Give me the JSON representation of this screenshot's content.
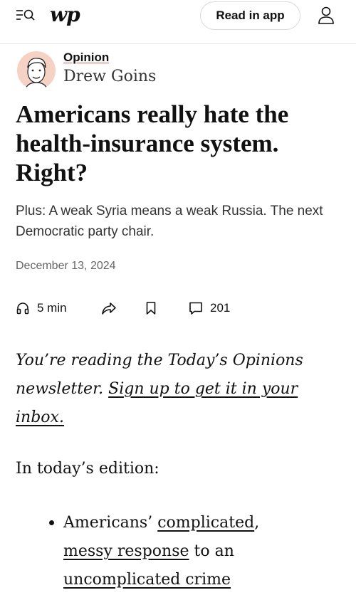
{
  "header": {
    "logo_text": "wp",
    "read_in_app_label": "Read in app"
  },
  "article": {
    "section": "Opinion",
    "author": "Drew Goins",
    "headline": "Americans really hate the health-insurance system. Right?",
    "subhead": "Plus: A weak Syria means a weak Russia. The next Democratic party chair.",
    "date": "December 13, 2024",
    "actions": {
      "listen_label": "5 min",
      "comments_count": "201"
    },
    "intro": {
      "text_before": "You’re reading the Today’s Opinions newsletter. ",
      "link_text": "Sign up to get it in your inbox."
    },
    "edition_heading": "In today’s edition:",
    "bullets": [
      {
        "prefix": "Americans’ ",
        "link1": "complicated",
        "sep": ", ",
        "link2": "messy response",
        "middle": " to an ",
        "link3": "uncomplicated crime"
      }
    ]
  },
  "colors": {
    "text": "#111111",
    "secondary_text": "#333333",
    "muted_text": "#666666",
    "avatar_bg": "#f6d2c4",
    "opinion_underline": "#e0695b"
  },
  "icons": [
    "menu-search-icon",
    "user-icon",
    "headphones-icon",
    "share-icon",
    "bookmark-icon",
    "comment-icon"
  ]
}
